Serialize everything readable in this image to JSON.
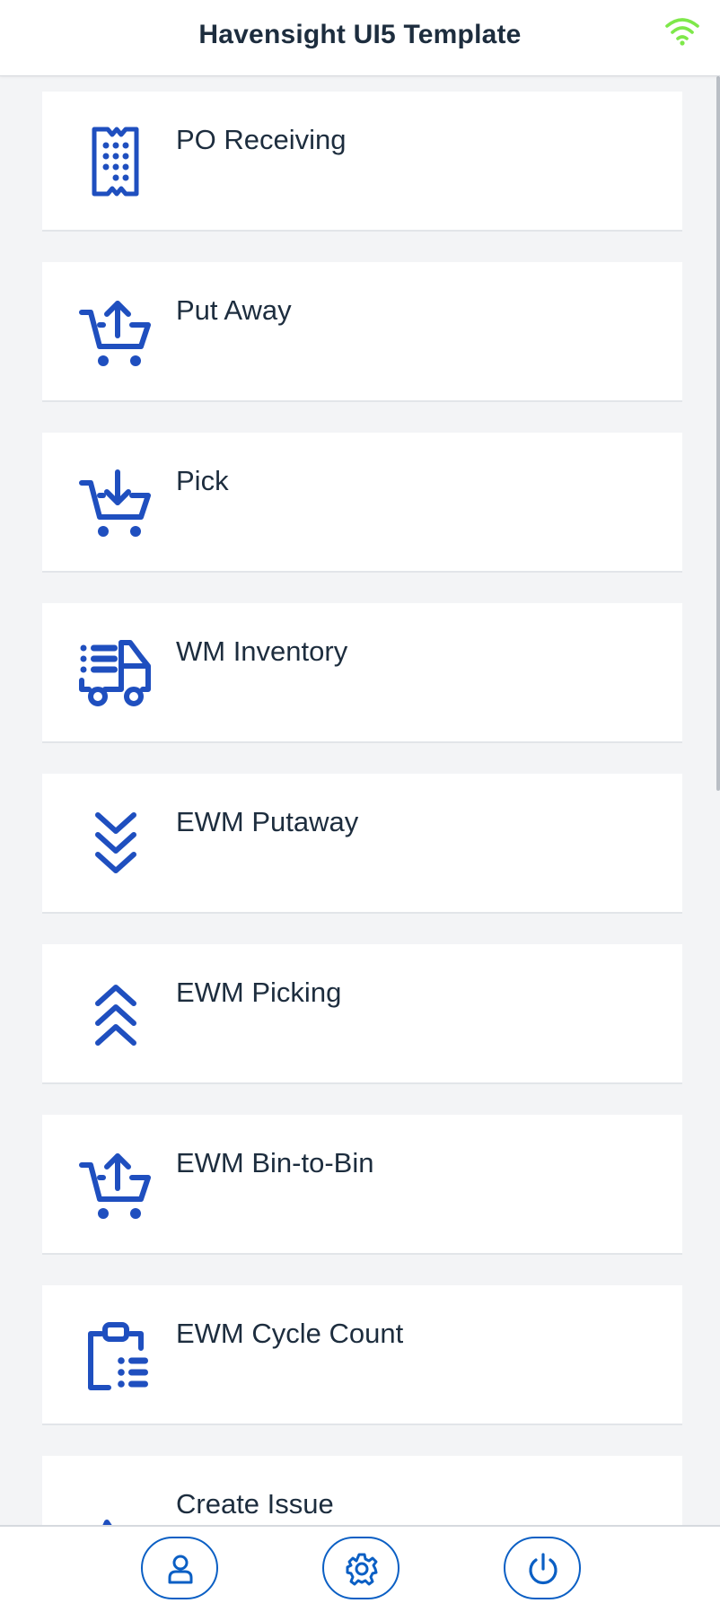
{
  "header": {
    "title": "Havensight UI5 Template",
    "status_icon": "wifi-icon",
    "status_color": "#7ee84a"
  },
  "theme": {
    "icon_color": "#1f4fbf",
    "text_color": "#1d2d3e",
    "footer_accent": "#0b5fc4"
  },
  "menu": {
    "items": [
      {
        "label": "PO Receiving",
        "icon": "receipt-icon"
      },
      {
        "label": "Put Away",
        "icon": "cart-upload-icon"
      },
      {
        "label": "Pick",
        "icon": "cart-download-icon"
      },
      {
        "label": "WM Inventory",
        "icon": "delivery-truck-icon"
      },
      {
        "label": "EWM Putaway",
        "icon": "double-chevron-down-icon"
      },
      {
        "label": "EWM Picking",
        "icon": "double-chevron-up-icon"
      },
      {
        "label": "EWM Bin-to-Bin",
        "icon": "cart-upload-icon"
      },
      {
        "label": "EWM Cycle Count",
        "icon": "clipboard-list-icon"
      },
      {
        "label": "Create Issue",
        "icon": "create-issue-icon"
      }
    ]
  },
  "footer": {
    "buttons": [
      {
        "icon": "user-icon"
      },
      {
        "icon": "gear-icon"
      },
      {
        "icon": "power-icon"
      }
    ]
  }
}
